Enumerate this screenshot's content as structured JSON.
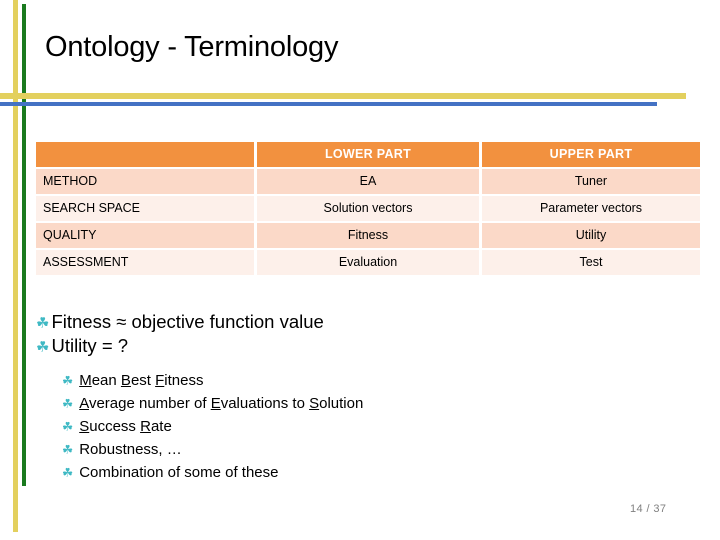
{
  "slide": {
    "title": "Ontology - Terminology",
    "page_number": "14 / 37"
  },
  "decor": {
    "vertical_yellow_color": "#E3D05E",
    "vertical_green_color": "#1A7A1E",
    "horizontal_yellow_color": "#E3D05E",
    "horizontal_blue_color": "#4472C4"
  },
  "table": {
    "header_fill": "#F2913F",
    "row_dark_fill": "#FBD9C8",
    "row_light_fill": "#FDF0EA",
    "columns": [
      "",
      "LOWER PART",
      "UPPER PART"
    ],
    "rows": [
      {
        "label": "METHOD",
        "lower": "EA",
        "upper": "Tuner"
      },
      {
        "label": "SEARCH SPACE",
        "lower": "Solution vectors",
        "upper": "Parameter vectors"
      },
      {
        "label": "QUALITY",
        "lower": "Fitness",
        "upper": "Utility"
      },
      {
        "label": "ASSESSMENT",
        "lower": "Evaluation",
        "upper": "Test"
      }
    ]
  },
  "bullets": {
    "glyph": "80",
    "glyph_color": "#3FB9C4",
    "level1": [
      "Fitness ≈ objective function value",
      "Utility = ?"
    ],
    "level2": [
      {
        "prefix_underline": "M",
        "rest_a": "ean ",
        "u2": "B",
        "rest_b": "est ",
        "u3": "F",
        "rest_c": "itness"
      },
      {
        "prefix_underline": "A",
        "rest_a": "verage number of ",
        "u2": "E",
        "rest_b": "valuations to ",
        "u3": "S",
        "rest_c": "olution"
      },
      {
        "prefix_underline": "S",
        "rest_a": "uccess ",
        "u2": "R",
        "rest_b": "ate",
        "u3": "",
        "rest_c": ""
      },
      {
        "prefix_underline": "",
        "rest_a": "Robustness, …",
        "u2": "",
        "rest_b": "",
        "u3": "",
        "rest_c": ""
      },
      {
        "prefix_underline": "",
        "rest_a": "Combination  of some of these",
        "u2": "",
        "rest_b": "",
        "u3": "",
        "rest_c": ""
      }
    ]
  }
}
